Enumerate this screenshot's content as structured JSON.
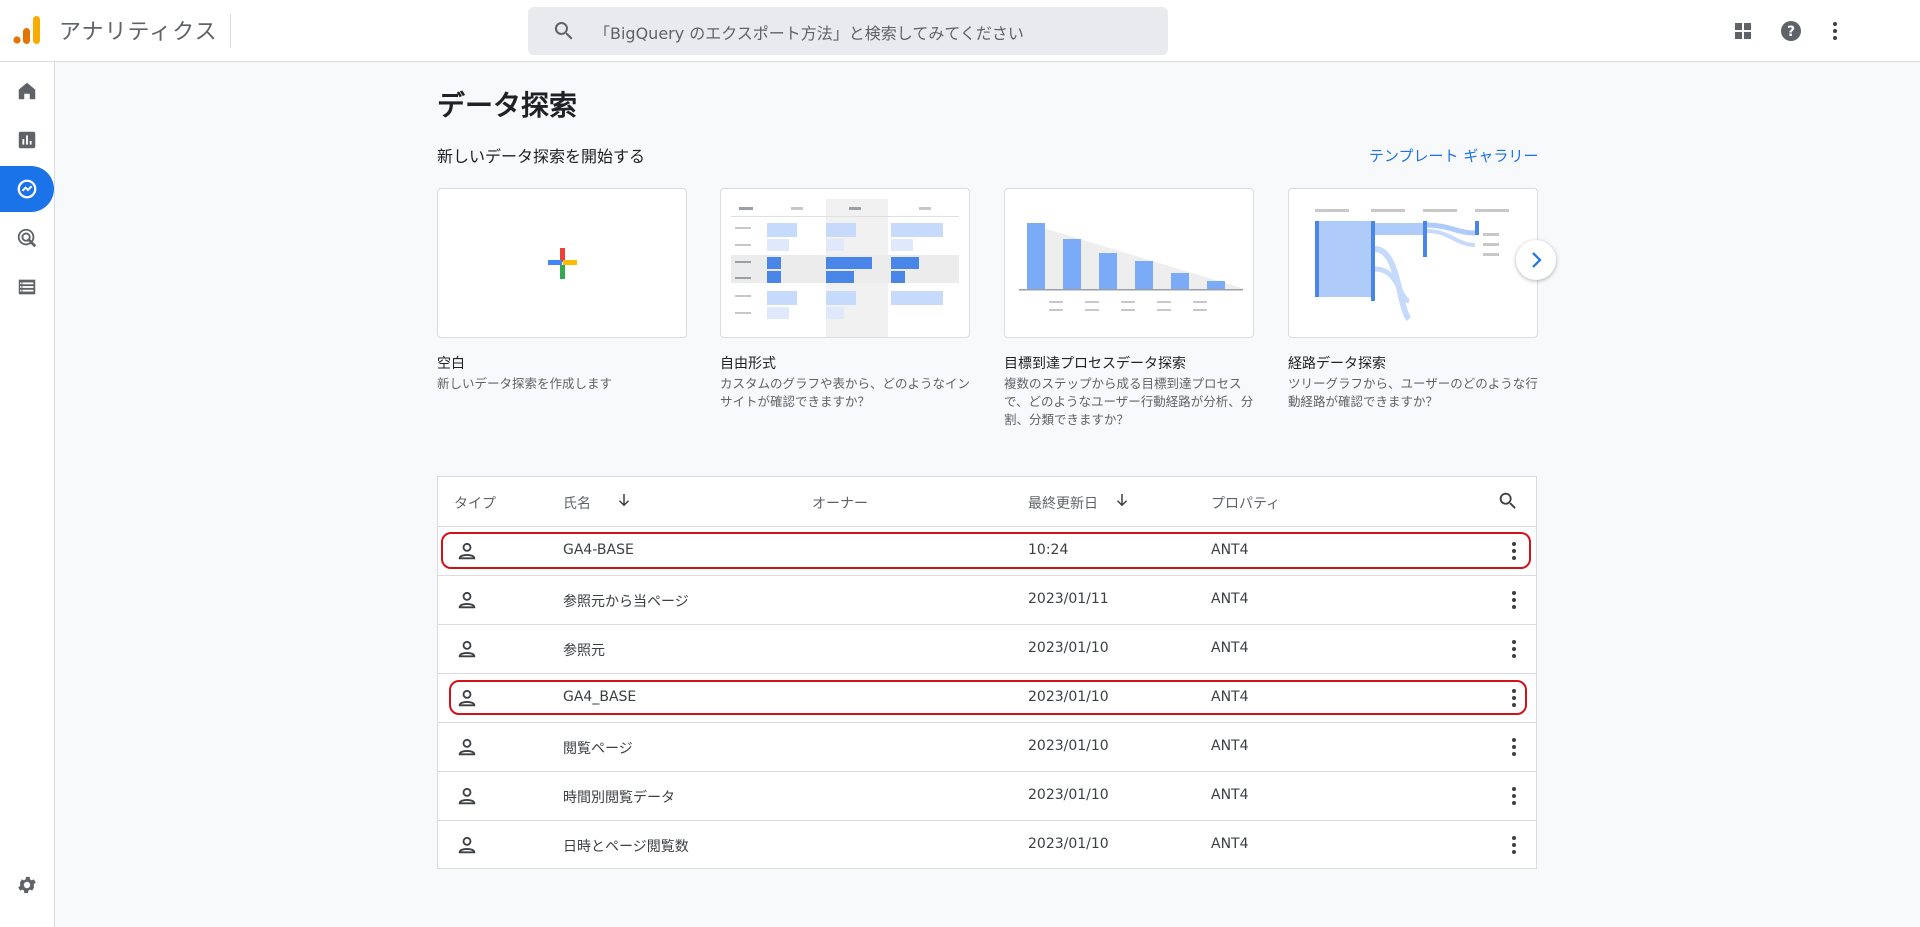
{
  "header": {
    "app_title": "アナリティクス",
    "search_placeholder": "「BigQuery のエクスポート方法」と検索してみてください"
  },
  "main": {
    "page_title": "データ探索",
    "section_title": "新しいデータ探索を開始する",
    "gallery_link": "テンプレート ギャラリー",
    "templates": [
      {
        "name": "空白",
        "description": "新しいデータ探索を作成します"
      },
      {
        "name": "自由形式",
        "description": "カスタムのグラフや表から、どのようなインサイトが確認できますか？"
      },
      {
        "name": "目標到達プロセスデータ探索",
        "description": "複数のステップから成る目標到達プロセスで、どのようなユーザー行動経路が分析、分割、分類できますか？"
      },
      {
        "name": "経路データ探索",
        "description": "ツリーグラフから、ユーザーのどのような行動経路が確認できますか？"
      }
    ]
  },
  "table": {
    "headers": {
      "type": "タイプ",
      "name": "氏名",
      "owner": "オーナー",
      "last_modified": "最終更新日",
      "property": "プロパティ"
    },
    "rows": [
      {
        "name": "GA4-BASE",
        "owner": "",
        "date": "10:24",
        "property": "ANT4",
        "highlighted": true
      },
      {
        "name": "参照元から当ページ",
        "owner": "",
        "date": "2023/01/11",
        "property": "ANT4",
        "highlighted": false
      },
      {
        "name": "参照元",
        "owner": "",
        "date": "2023/01/10",
        "property": "ANT4",
        "highlighted": false
      },
      {
        "name": "GA4_BASE",
        "owner": "",
        "date": "2023/01/10",
        "property": "ANT4",
        "highlighted": true
      },
      {
        "name": "閲覧ページ",
        "owner": "",
        "date": "2023/01/10",
        "property": "ANT4",
        "highlighted": false
      },
      {
        "name": "時間別閲覧データ",
        "owner": "",
        "date": "2023/01/10",
        "property": "ANT4",
        "highlighted": false
      },
      {
        "name": "日時とページ閲覧数",
        "owner": "",
        "date": "2023/01/10",
        "property": "ANT4",
        "highlighted": false
      }
    ]
  },
  "colors": {
    "accent": "#1a73e8",
    "highlight_outline": "#d0121b",
    "logo_orange": "#f9ab00",
    "logo_dark_orange": "#e37400"
  },
  "icons": {
    "rail": [
      "home-icon",
      "reports-icon",
      "explore-icon",
      "advertising-icon",
      "configure-icon",
      "settings-icon"
    ],
    "header": [
      "apps-grid-icon",
      "help-icon",
      "more-vert-icon"
    ]
  }
}
